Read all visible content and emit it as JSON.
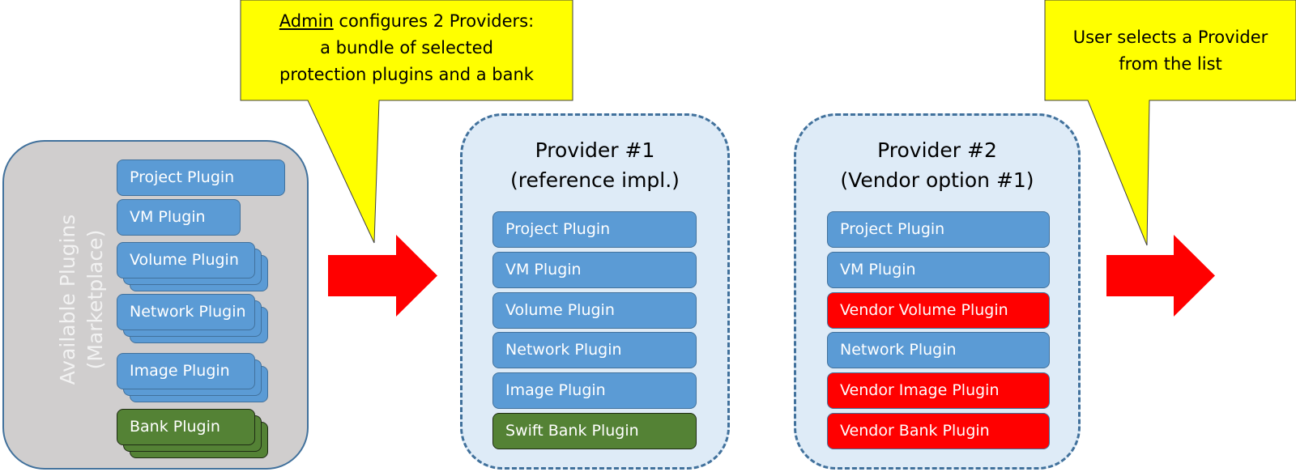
{
  "colors": {
    "plugin_blue": "#5b9bd5",
    "bank_green": "#548235",
    "vendor_red": "#ff0000",
    "callout_yellow": "#ffff00",
    "marketplace_gray": "#d0cece",
    "provider_bg": "#deebf7",
    "border_blue": "#41719c",
    "arrow_red": "#ff0000"
  },
  "marketplace": {
    "title_line1": "Available Plugins",
    "title_line2": "(Marketplace)",
    "plugins": [
      {
        "label": "Project Plugin",
        "kind": "protection",
        "stacked": false
      },
      {
        "label": "VM Plugin",
        "kind": "protection",
        "stacked": false
      },
      {
        "label": "Volume Plugin",
        "kind": "protection",
        "stacked": true
      },
      {
        "label": "Network Plugin",
        "kind": "protection",
        "stacked": true
      },
      {
        "label": "Image Plugin",
        "kind": "protection",
        "stacked": true
      },
      {
        "label": "Bank Plugin",
        "kind": "bank",
        "stacked": true
      }
    ]
  },
  "callouts": {
    "admin": {
      "emphasis": "Admin",
      "line1_rest": " configures 2 Providers:",
      "line2": "a bundle of selected",
      "line3": "protection plugins and a bank"
    },
    "user": {
      "line1": "User selects a Provider",
      "line2": "from the list"
    }
  },
  "providers": [
    {
      "title_line1": "Provider #1",
      "title_line2": "(reference impl.)",
      "plugins": [
        {
          "label": "Project Plugin",
          "kind": "protection"
        },
        {
          "label": "VM Plugin",
          "kind": "protection"
        },
        {
          "label": "Volume Plugin",
          "kind": "protection"
        },
        {
          "label": "Network Plugin",
          "kind": "protection"
        },
        {
          "label": "Image Plugin",
          "kind": "protection"
        },
        {
          "label": "Swift Bank Plugin",
          "kind": "bank"
        }
      ]
    },
    {
      "title_line1": "Provider #2",
      "title_line2": "(Vendor option #1)",
      "plugins": [
        {
          "label": "Project Plugin",
          "kind": "protection"
        },
        {
          "label": "VM Plugin",
          "kind": "protection"
        },
        {
          "label": "Vendor Volume Plugin",
          "kind": "vendor"
        },
        {
          "label": "Network Plugin",
          "kind": "protection"
        },
        {
          "label": "Vendor Image Plugin",
          "kind": "vendor"
        },
        {
          "label": "Vendor Bank Plugin",
          "kind": "vendor"
        }
      ]
    }
  ]
}
